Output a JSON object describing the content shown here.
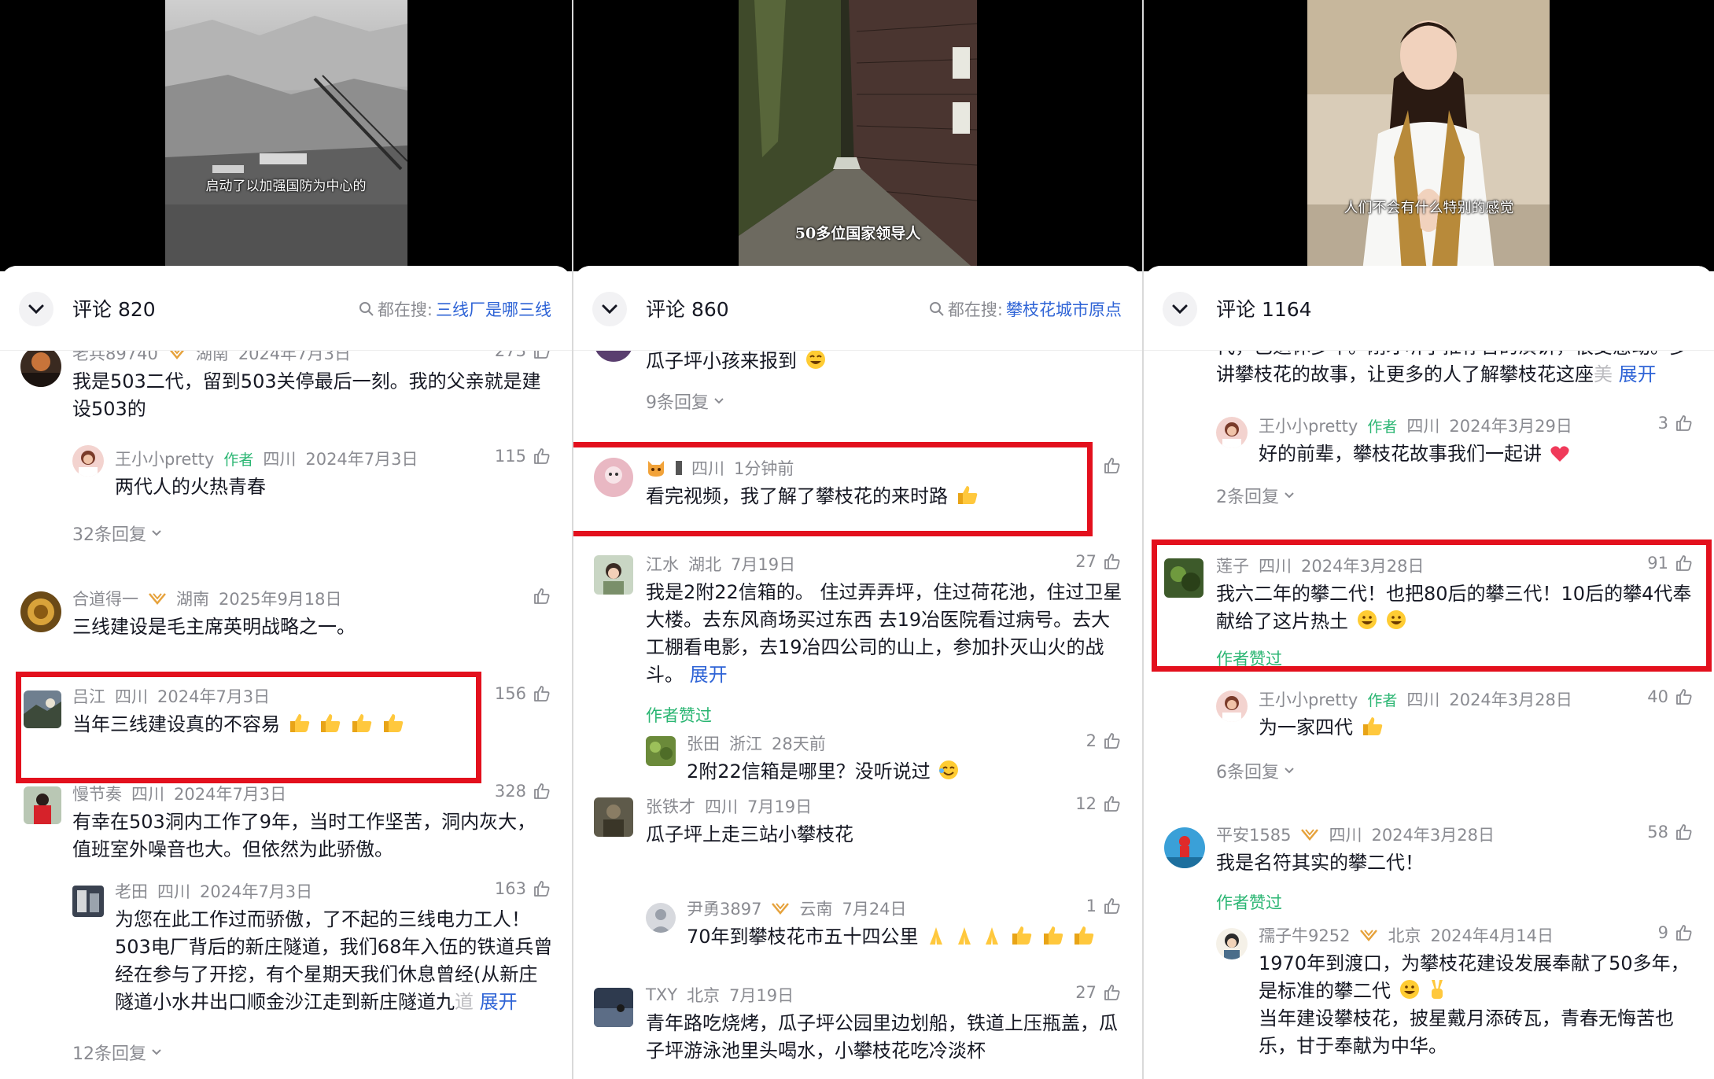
{
  "colors": {
    "accent_blue": "#2f64d6",
    "author_green": "#2bb673",
    "highlight_red": "#e3101d",
    "meta_grey": "#8a8b91"
  },
  "panels": [
    {
      "subtitle": "启动了以加强国防为中心的",
      "count_label": "评论 820",
      "search_prefix": "都在搜:",
      "search_keyword": "三线厂是哪三线",
      "comments": [
        {
          "name": "老兵89740",
          "location": "湖南",
          "date": "2024年7月3日",
          "likes": "273",
          "text": "我是503二代，留到503关停最后一刻。我的父亲就是建设503的"
        },
        {
          "name": "王小小pretty",
          "author_tag": "作者",
          "location": "四川",
          "date": "2024年7月3日",
          "likes": "115",
          "text": "两代人的火热青春"
        },
        {
          "replies": "32条回复"
        },
        {
          "name": "合道得一",
          "location": "湖南",
          "date": "2025年9月18日",
          "text": "三线建设是毛主席英明战略之一。"
        },
        {
          "name": "吕江",
          "location": "四川",
          "date": "2024年7月3日",
          "likes": "156",
          "text": "当年三线建设真的不容易"
        },
        {
          "name": "慢节奏",
          "location": "四川",
          "date": "2024年7月3日",
          "likes": "328",
          "text": "有幸在503洞内工作了9年，当时工作坚苦，洞内灰大，值班室外噪音也大。但依然为此骄傲。"
        },
        {
          "name": "老田",
          "location": "四川",
          "date": "2024年7月3日",
          "likes": "163",
          "text": "为您在此工作过而骄傲，了不起的三线电力工人！503电厂背后的新庄隧道，我们68年入伍的铁道兵曾经在参与了开挖，有个星期天我们休息曾经(从新庄隧道小水井出口顺金沙江走到新庄隧道九",
          "fade": "道",
          "expand": "展开"
        },
        {
          "replies": "12条回复"
        }
      ]
    },
    {
      "subtitle": "50多位国家领导人",
      "count_label": "评论 860",
      "search_prefix": "都在搜:",
      "search_keyword": "攀枝花城市原点",
      "comments": [
        {
          "text": "瓜子坪小孩来报到"
        },
        {
          "replies": "9条回复"
        },
        {
          "name": "",
          "location": "四川",
          "date": "1分钟前",
          "text": "看完视频，我了解了攀枝花的来时路"
        },
        {
          "name": "江水",
          "location": "湖北",
          "date": "7月19日",
          "likes": "27",
          "text": "我是2附22信箱的。 住过弄弄坪，住过荷花池，住过卫星大楼。去东风商场买过东西 去19冶医院看过病号。去大工棚看电影，去19冶四公司的山上，参加扑灭山火的战斗。",
          "expand": "展开",
          "liked": "作者赞过"
        },
        {
          "name": "张田",
          "location": "浙江",
          "date": "28天前",
          "likes": "2",
          "text": "2附22信箱是哪里？没听说过"
        },
        {
          "name": "张铁才",
          "location": "四川",
          "date": "7月19日",
          "likes": "12",
          "text": "瓜子坪上走三站小攀枝花"
        },
        {
          "name": "尹勇3897",
          "location": "云南",
          "date": "7月24日",
          "likes": "1",
          "text": "70年到攀枝花市五十四公里"
        },
        {
          "name": "TXY",
          "location": "北京",
          "date": "7月19日",
          "likes": "27",
          "text": "青年路吃烧烤，瓜子坪公园里边划船，铁道上压瓶盖，瓜子坪游泳池里头喝水，小攀枝花吃冷淡杯"
        }
      ]
    },
    {
      "subtitle": "人们不会有什么特别的感觉",
      "count_label": "评论 1164",
      "comments": [
        {
          "text": "代，已退休多年。刚才听了推荐官的演讲，很受感动。多讲攀枝花的故事，让更多的人了解攀枝花这座",
          "fade": "美",
          "expand": "展开"
        },
        {
          "name": "王小小pretty",
          "author_tag": "作者",
          "location": "四川",
          "date": "2024年3月29日",
          "likes": "3",
          "text": "好的前辈，攀枝花故事我们一起讲"
        },
        {
          "replies": "2条回复"
        },
        {
          "name": "莲子",
          "location": "四川",
          "date": "2024年3月28日",
          "likes": "91",
          "text": "我六二年的攀二代！也把80后的攀三代！10后的攀4代奉献给了这片热土",
          "liked": "作者赞过"
        },
        {
          "name": "王小小pretty",
          "author_tag": "作者",
          "location": "四川",
          "date": "2024年3月28日",
          "likes": "40",
          "text": "为一家四代"
        },
        {
          "replies": "6条回复"
        },
        {
          "name": "平安1585",
          "location": "四川",
          "date": "2024年3月28日",
          "likes": "58",
          "text": "我是名符其实的攀二代！",
          "liked": "作者赞过"
        },
        {
          "name": "孺子牛9252",
          "location": "北京",
          "date": "2024年4月14日",
          "likes": "9",
          "text": "1970年到渡口，为攀枝花建设发展奉献了50多年，是标准的攀二代",
          "text2": "当年建设攀枝花，披星戴月添砖瓦，青春无悔苦也乐，甘于奉献为中华。"
        }
      ]
    }
  ]
}
